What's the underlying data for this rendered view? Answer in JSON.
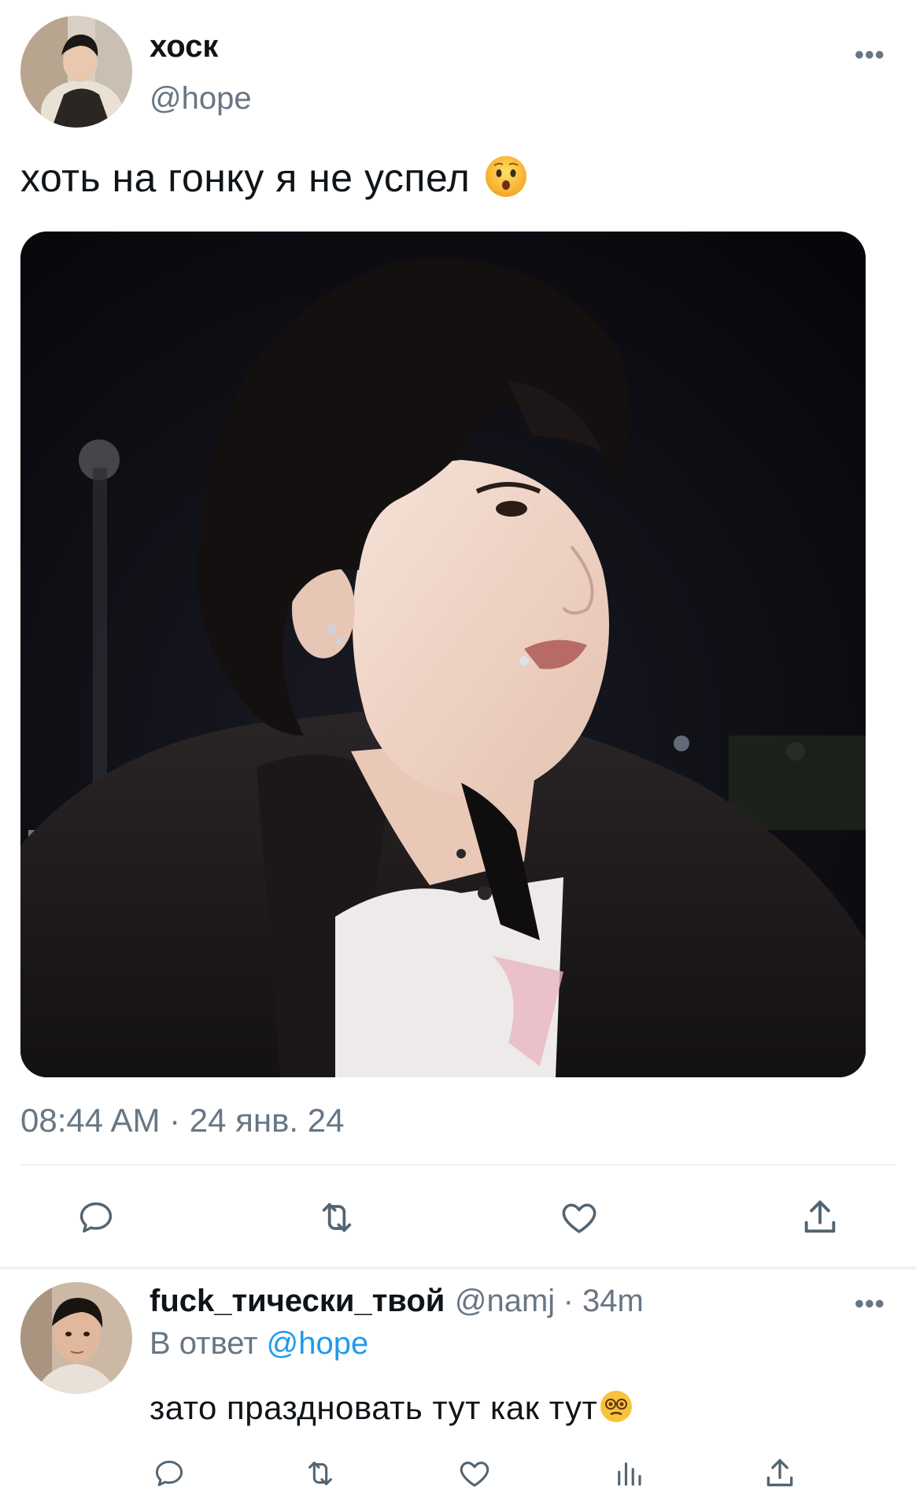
{
  "tweet": {
    "author_name": "хоск",
    "author_handle": "@hope",
    "more_label": "•••",
    "text": "хоть на гонку я не успел",
    "text_emoji": "hushed-face",
    "timestamp": "08:44 AM · 24 янв. 24",
    "actions": [
      "reply-icon",
      "retweet-icon",
      "like-icon",
      "share-icon"
    ]
  },
  "reply": {
    "author_name": "fuck_тически_твой",
    "author_handle": "@namj",
    "age": "· 34m",
    "more_label": "•••",
    "in_reply_prefix": "В ответ",
    "in_reply_handle": "@hope",
    "text": "зато праздновать тут как тут",
    "text_emoji": "dizzy-face",
    "actions": [
      "reply-icon",
      "retweet-icon",
      "like-icon",
      "views-icon",
      "share-icon"
    ]
  },
  "colors": {
    "text_primary": "#0f1419",
    "text_secondary": "#687684",
    "link": "#1d9bf0",
    "divider": "#eff3f4"
  }
}
